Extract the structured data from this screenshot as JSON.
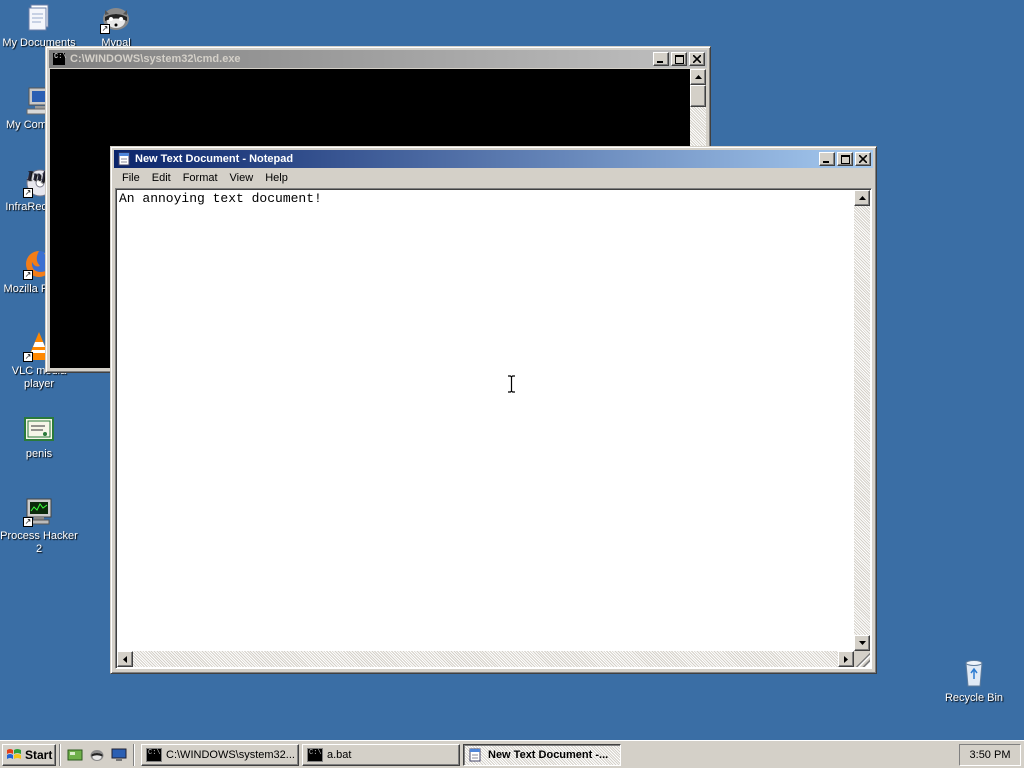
{
  "desktop": {
    "icons": [
      {
        "label": "My Documents",
        "icon": "my-documents-icon"
      },
      {
        "label": "Mypal",
        "icon": "mypal-raccoon-icon"
      },
      {
        "label": "My Computer",
        "icon": "my-computer-icon"
      },
      {
        "label": "InfraRecorder",
        "icon": "infrarecorder-icon"
      },
      {
        "label": "Mozilla Firefox",
        "icon": "firefox-icon"
      },
      {
        "label": "VLC media player",
        "icon": "vlc-icon"
      },
      {
        "label": "penis",
        "icon": "certificate-file-icon"
      },
      {
        "label": "Process Hacker 2",
        "icon": "process-hacker-icon"
      },
      {
        "label": "Recycle Bin",
        "icon": "recycle-bin-icon"
      }
    ]
  },
  "cmd_window": {
    "title": "C:\\WINDOWS\\system32\\cmd.exe",
    "active": false
  },
  "notepad": {
    "title": "New Text Document - Notepad",
    "active": true,
    "menu": [
      "File",
      "Edit",
      "Format",
      "View",
      "Help"
    ],
    "content": "An annoying text document!"
  },
  "taskbar": {
    "start_label": "Start",
    "quick_launch": [
      "show-desktop-icon",
      "mypal-raccoon-icon",
      "monitor-icon"
    ],
    "tasks": [
      {
        "label": "C:\\WINDOWS\\system32...",
        "icon": "cmd-icon",
        "pressed": false
      },
      {
        "label": "a.bat",
        "icon": "cmd-icon",
        "pressed": false
      },
      {
        "label": "New Text Document -...",
        "icon": "notepad-icon",
        "pressed": true
      }
    ],
    "clock": "3:50 PM"
  },
  "colors": {
    "desktop": "#3a6ea5",
    "active_title_start": "#0a246a",
    "active_title_end": "#a6caf0",
    "inactive_title_start": "#808080",
    "window_face": "#d4d0c8"
  }
}
